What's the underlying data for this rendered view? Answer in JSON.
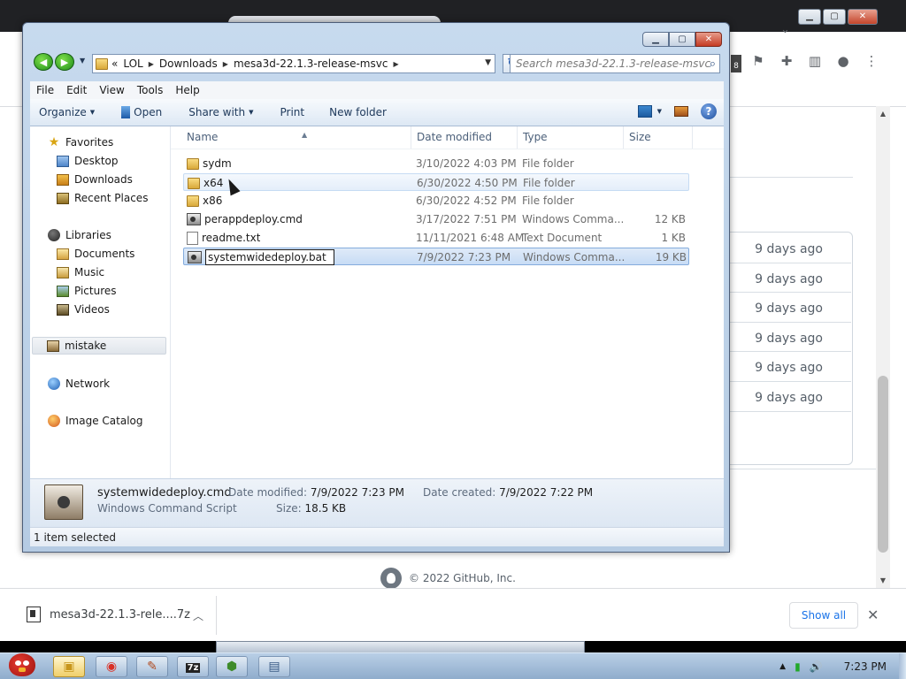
{
  "explorer": {
    "breadcrumb": [
      "LOL",
      "Downloads",
      "mesa3d-22.1.3-release-msvc"
    ],
    "search_placeholder": "Search mesa3d-22.1.3-release-msvc",
    "menu": [
      "File",
      "Edit",
      "View",
      "Tools",
      "Help"
    ],
    "commands": {
      "organize": "Organize",
      "open": "Open",
      "share_with": "Share with",
      "print": "Print",
      "new_folder": "New folder"
    },
    "nav": {
      "favorites": "Favorites",
      "desktop": "Desktop",
      "downloads": "Downloads",
      "recent_places": "Recent Places",
      "libraries": "Libraries",
      "documents": "Documents",
      "music": "Music",
      "pictures": "Pictures",
      "videos": "Videos",
      "user": "mistake",
      "network": "Network",
      "image_catalog": "Image Catalog"
    },
    "columns": {
      "name": "Name",
      "date": "Date modified",
      "type": "Type",
      "size": "Size"
    },
    "files": [
      {
        "name": "sydm",
        "date": "3/10/2022 4:03 PM",
        "type": "File folder",
        "size": "",
        "icon": "folder-icon"
      },
      {
        "name": "x64",
        "date": "6/30/2022 4:50 PM",
        "type": "File folder",
        "size": "",
        "icon": "folder-icon"
      },
      {
        "name": "x86",
        "date": "6/30/2022 4:52 PM",
        "type": "File folder",
        "size": "",
        "icon": "folder-icon"
      },
      {
        "name": "perappdeploy.cmd",
        "date": "3/17/2022 7:51 PM",
        "type": "Windows Comma...",
        "size": "12 KB",
        "icon": "cmd-script-icon"
      },
      {
        "name": "readme.txt",
        "date": "11/11/2021 6:48 AM",
        "type": "Text Document",
        "size": "1 KB",
        "icon": "text-file-icon"
      },
      {
        "name": "systemwidedeploy.bat",
        "date": "7/9/2022 7:23 PM",
        "type": "Windows Comma...",
        "size": "19 KB",
        "icon": "cmd-script-icon"
      }
    ],
    "details": {
      "name": "systemwidedeploy.cmd",
      "type": "Windows Command Script",
      "date_modified_label": "Date modified:",
      "date_modified": "7/9/2022 7:23 PM",
      "size_label": "Size:",
      "size": "18.5 KB",
      "date_created_label": "Date created:",
      "date_created": "7/9/2022 7:22 PM"
    },
    "status": "1 item selected"
  },
  "browser": {
    "relative_times": [
      "9 days ago",
      "9 days ago",
      "9 days ago",
      "9 days ago",
      "9 days ago",
      "9 days ago"
    ],
    "footer": "© 2022 GitHub, Inc.",
    "download_file": "mesa3d-22.1.3-rele....7z",
    "show_all": "Show all",
    "extension_badge": "8"
  },
  "taskbar": {
    "clock": "7:23 PM"
  },
  "colors": {
    "explorer_frame": "#b5cbe3",
    "selection": "#c7dcf5",
    "link_blue": "#1a73e8",
    "taskbar": "#8eabcb"
  }
}
